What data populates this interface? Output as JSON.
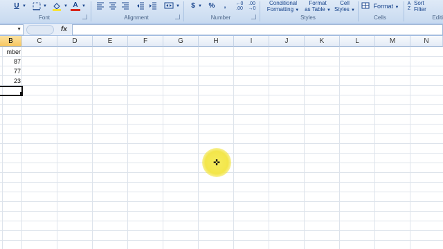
{
  "ribbon": {
    "font_group": {
      "label": "Font",
      "underline": "U",
      "font_color_letter": "A"
    },
    "alignment_group": {
      "label": "Alignment"
    },
    "number_group": {
      "label": "Number",
      "currency": "$",
      "percent": "%",
      "comma": ","
    },
    "styles_group": {
      "label": "Styles",
      "conditional_formatting": [
        "Conditional",
        "Formatting"
      ],
      "format_as_table": [
        "Format",
        "as Table"
      ],
      "cell_styles": [
        "Cell",
        "Styles"
      ]
    },
    "cells_group": {
      "label": "Cells",
      "format": "Format"
    },
    "editing_group": {
      "label": "Editi",
      "sort_filter": [
        "Sort",
        "Filter"
      ]
    }
  },
  "formula_bar": {
    "fx": "fx",
    "content": ""
  },
  "sheet": {
    "columns": [
      "B",
      "C",
      "D",
      "E",
      "F",
      "G",
      "H",
      "I",
      "J",
      "K",
      "L",
      "M",
      "N"
    ],
    "active_column": "B",
    "column_b_values": [
      "mber",
      "87",
      "77",
      "23"
    ]
  },
  "colors": {
    "ribbon": "#d2e1f3",
    "header_active": "#f7c65e",
    "cursor_highlight": "#f3e64a"
  }
}
